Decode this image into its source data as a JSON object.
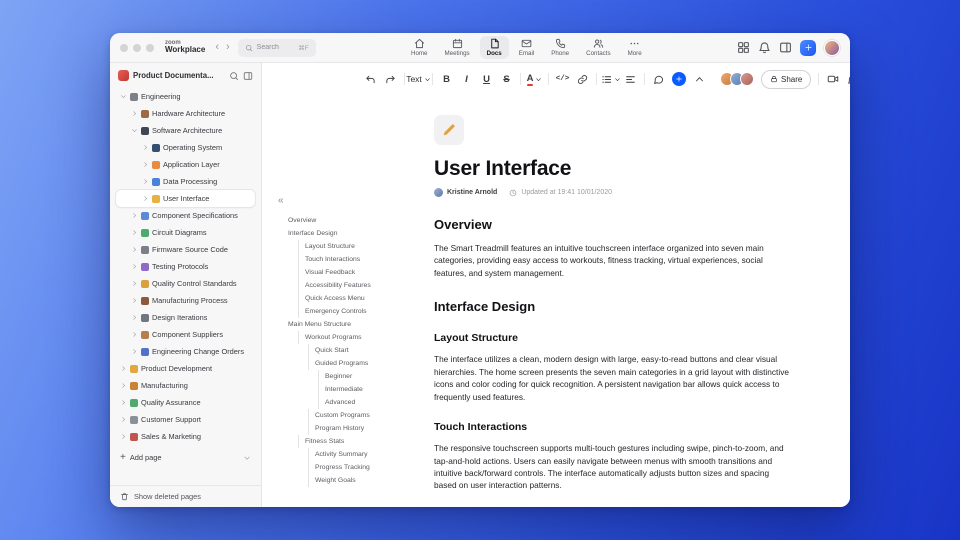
{
  "app": {
    "brand_top": "zoom",
    "brand_bottom": "Workplace",
    "search": {
      "placeholder": "Search",
      "shortcut": "⌘F"
    },
    "tabs": [
      {
        "label": "Home",
        "icon": "home",
        "active": false
      },
      {
        "label": "Meetings",
        "icon": "cal",
        "active": false
      },
      {
        "label": "Docs",
        "icon": "doc",
        "active": true
      },
      {
        "label": "Email",
        "icon": "mail",
        "active": false
      },
      {
        "label": "Phone",
        "icon": "phone",
        "active": false
      },
      {
        "label": "Contacts",
        "icon": "users",
        "active": false
      },
      {
        "label": "More",
        "icon": "more",
        "active": false
      }
    ]
  },
  "sidebar": {
    "title": "Product Documenta...",
    "add_page": "Add page",
    "show_deleted": "Show deleted pages",
    "tree": [
      {
        "label": "Engineering",
        "level": 0,
        "expanded": true,
        "color": "#7d8089"
      },
      {
        "label": "Hardware Architecture",
        "level": 1,
        "expanded": false,
        "color": "#9c6b45"
      },
      {
        "label": "Software Architecture",
        "level": 1,
        "expanded": true,
        "color": "#3f4753"
      },
      {
        "label": "Operating System",
        "level": 2,
        "expanded": false,
        "color": "#35506e"
      },
      {
        "label": "Application Layer",
        "level": 2,
        "expanded": false,
        "color": "#e78b3c"
      },
      {
        "label": "Data Processing",
        "level": 2,
        "expanded": false,
        "color": "#4a84d8"
      },
      {
        "label": "User Interface",
        "level": 2,
        "expanded": false,
        "color": "#e8b23f",
        "selected": true
      },
      {
        "label": "Component Specifications",
        "level": 1,
        "expanded": false,
        "color": "#5b8ad6"
      },
      {
        "label": "Circuit Diagrams",
        "level": 1,
        "expanded": false,
        "color": "#4faa6d"
      },
      {
        "label": "Firmware Source Code",
        "level": 1,
        "expanded": false,
        "color": "#7a7f88"
      },
      {
        "label": "Testing Protocols",
        "level": 1,
        "expanded": false,
        "color": "#8f6bc9"
      },
      {
        "label": "Quality Control Standards",
        "level": 1,
        "expanded": false,
        "color": "#d9a23c"
      },
      {
        "label": "Manufacturing Process",
        "level": 1,
        "expanded": false,
        "color": "#8a5a3b"
      },
      {
        "label": "Design Iterations",
        "level": 1,
        "expanded": false,
        "color": "#6f7680"
      },
      {
        "label": "Component Suppliers",
        "level": 1,
        "expanded": false,
        "color": "#b5804e"
      },
      {
        "label": "Engineering Change Orders",
        "level": 1,
        "expanded": false,
        "color": "#5570c9"
      },
      {
        "label": "Product Development",
        "level": 0,
        "expanded": false,
        "color": "#e2a83d"
      },
      {
        "label": "Manufacturing",
        "level": 0,
        "expanded": false,
        "color": "#c98136"
      },
      {
        "label": "Quality Assurance",
        "level": 0,
        "expanded": false,
        "color": "#4faa6d"
      },
      {
        "label": "Customer Support",
        "level": 0,
        "expanded": false,
        "color": "#8a9097"
      },
      {
        "label": "Sales & Marketing",
        "level": 0,
        "expanded": false,
        "color": "#c25450"
      }
    ]
  },
  "outline": {
    "collapse": "«",
    "items": [
      {
        "label": "Overview",
        "level": 0
      },
      {
        "label": "Interface Design",
        "level": 0
      },
      {
        "label": "Layout Structure",
        "level": 1
      },
      {
        "label": "Touch Interactions",
        "level": 1
      },
      {
        "label": "Visual Feedback",
        "level": 1
      },
      {
        "label": "Accessibility Features",
        "level": 1
      },
      {
        "label": "Quick Access Menu",
        "level": 1
      },
      {
        "label": "Emergency Controls",
        "level": 1
      },
      {
        "label": "Main Menu Structure",
        "level": 0
      },
      {
        "label": "Workout Programs",
        "level": 1
      },
      {
        "label": "Quick Start",
        "level": 2
      },
      {
        "label": "Guided Programs",
        "level": 2
      },
      {
        "label": "Beginner",
        "level": 3
      },
      {
        "label": "Intermediate",
        "level": 3
      },
      {
        "label": "Advanced",
        "level": 3
      },
      {
        "label": "Custom Programs",
        "level": 2
      },
      {
        "label": "Program History",
        "level": 2
      },
      {
        "label": "Fitness Stats",
        "level": 1
      },
      {
        "label": "Activity Summary",
        "level": 2
      },
      {
        "label": "Progress Tracking",
        "level": 2
      },
      {
        "label": "Weight Goals",
        "level": 2
      }
    ]
  },
  "toolbar": {
    "style_label": "Text",
    "share_label": "Share"
  },
  "doc": {
    "title": "User Interface",
    "author": "Kristine Arnold",
    "updated": "Updated at 19:41 10/01/2020",
    "sections": [
      {
        "type": "h2",
        "text": "Overview"
      },
      {
        "type": "p",
        "text": "The Smart Treadmill features an intuitive touchscreen interface organized into seven main categories, providing easy access to workouts, fitness tracking, virtual experiences, social features, and system management."
      },
      {
        "type": "h2",
        "text": "Interface Design"
      },
      {
        "type": "h3",
        "text": "Layout Structure"
      },
      {
        "type": "p",
        "text": "The interface utilizes a clean, modern design with large, easy-to-read buttons and clear visual hierarchies. The home screen presents the seven main categories in a grid layout with distinctive icons and color coding for quick recognition. A persistent navigation bar allows quick access to frequently used features."
      },
      {
        "type": "h3",
        "text": "Touch Interactions"
      },
      {
        "type": "p",
        "text": "The responsive touchscreen supports multi-touch gestures including swipe, pinch-to-zoom, and tap-and-hold actions. Users can easily navigate between menus with smooth transitions and intuitive back/forward controls. The interface automatically adjusts button sizes and spacing based on user interaction patterns."
      }
    ]
  },
  "colors": {
    "accent": "#0b5cff",
    "window_bg": "#ffffff",
    "sidebar_bg": "#f7f7f8"
  }
}
